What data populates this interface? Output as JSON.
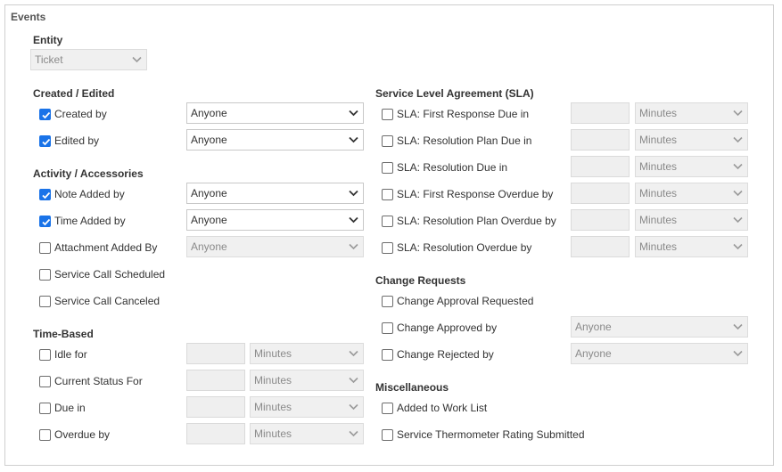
{
  "panel": {
    "title": "Events"
  },
  "entity": {
    "label": "Entity",
    "value": "Ticket"
  },
  "sections": {
    "created_edited": "Created / Edited",
    "activity": "Activity / Accessories",
    "time_based": "Time-Based",
    "sla": "Service Level Agreement (SLA)",
    "change_requests": "Change Requests",
    "misc": "Miscellaneous"
  },
  "created_edited": [
    {
      "label": "Created by",
      "checked": true,
      "select": "Anyone"
    },
    {
      "label": "Edited by",
      "checked": true,
      "select": "Anyone"
    }
  ],
  "activity": [
    {
      "label": "Note Added by",
      "checked": true,
      "select": "Anyone"
    },
    {
      "label": "Time Added by",
      "checked": true,
      "select": "Anyone"
    },
    {
      "label": "Attachment Added By",
      "checked": false,
      "select": "Anyone"
    },
    {
      "label": "Service Call Scheduled",
      "checked": false
    },
    {
      "label": "Service Call Canceled",
      "checked": false
    }
  ],
  "time_based": [
    {
      "label": "Idle for",
      "checked": false,
      "unit": "Minutes"
    },
    {
      "label": "Current Status For",
      "checked": false,
      "unit": "Minutes"
    },
    {
      "label": "Due in",
      "checked": false,
      "unit": "Minutes"
    },
    {
      "label": "Overdue by",
      "checked": false,
      "unit": "Minutes"
    }
  ],
  "sla": [
    {
      "label": "SLA: First Response Due in",
      "checked": false,
      "unit": "Minutes"
    },
    {
      "label": "SLA: Resolution Plan Due in",
      "checked": false,
      "unit": "Minutes"
    },
    {
      "label": "SLA: Resolution Due in",
      "checked": false,
      "unit": "Minutes"
    },
    {
      "label": "SLA: First Response Overdue by",
      "checked": false,
      "unit": "Minutes"
    },
    {
      "label": "SLA: Resolution Plan Overdue by",
      "checked": false,
      "unit": "Minutes"
    },
    {
      "label": "SLA: Resolution Overdue by",
      "checked": false,
      "unit": "Minutes"
    }
  ],
  "change_requests": [
    {
      "label": "Change Approval Requested",
      "checked": false
    },
    {
      "label": "Change Approved by",
      "checked": false,
      "select": "Anyone"
    },
    {
      "label": "Change Rejected by",
      "checked": false,
      "select": "Anyone"
    }
  ],
  "misc": [
    {
      "label": "Added to Work List",
      "checked": false
    },
    {
      "label": "Service Thermometer Rating Submitted",
      "checked": false
    }
  ],
  "colors": {
    "accent": "#1a73e8",
    "border": "#cfcfcf",
    "disabled_bg": "#f0f0f0"
  }
}
